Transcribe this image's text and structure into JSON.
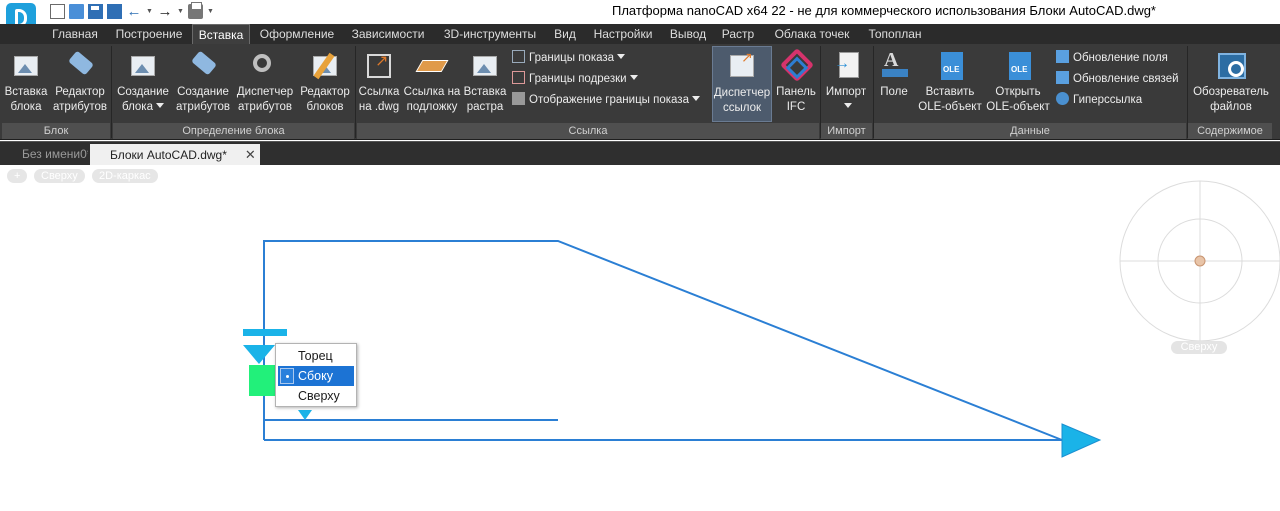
{
  "window": {
    "title": "Платформа nanoCAD x64 22 - не для коммерческого использования Блоки AutoCAD.dwg*"
  },
  "quick_access": {
    "icons": [
      "new-icon",
      "open-icon",
      "save-icon",
      "save-all-icon",
      "undo-icon",
      "redo-icon",
      "print-icon",
      "customize-icon"
    ]
  },
  "ribbon_tabs": [
    "Главная",
    "Построение",
    "Вставка",
    "Оформление",
    "Зависимости",
    "3D-инструменты",
    "Вид",
    "Настройки",
    "Вывод",
    "Растр",
    "Облака точек",
    "Топоплан"
  ],
  "active_tab": "Вставка",
  "ribbon": {
    "groups": {
      "block": "Блок",
      "block_def": "Определение блока",
      "reference": "Ссылка",
      "import": "Импорт",
      "data": "Данные",
      "content": "Содержимое"
    },
    "buttons": {
      "insert_block": [
        "Вставка",
        "блока"
      ],
      "attr_editor": [
        "Редактор",
        "атрибутов"
      ],
      "create_block": [
        "Создание",
        "блока"
      ],
      "create_attrs": [
        "Создание",
        "атрибутов"
      ],
      "attr_manager": [
        "Диспетчер",
        "атрибутов"
      ],
      "block_editor": [
        "Редактор",
        "блоков"
      ],
      "ref_dwg": [
        "Ссылка",
        "на .dwg"
      ],
      "ref_underlay": [
        "Ссылка на",
        "подложку"
      ],
      "insert_raster": [
        "Вставка",
        "растра"
      ],
      "ref_manager": [
        "Диспетчер",
        "ссылок"
      ],
      "ifc_panel": [
        "Панель",
        "IFC"
      ],
      "import": [
        "Импорт",
        ""
      ],
      "field": [
        "Поле",
        ""
      ],
      "insert_ole": [
        "Вставить",
        "OLE-объект"
      ],
      "open_ole": [
        "Открыть",
        "OLE-объект"
      ],
      "file_browser": [
        "Обозреватель",
        "файлов"
      ]
    },
    "small": {
      "display_bounds": "Границы показа",
      "clip_bounds": "Границы подрезки",
      "show_clip_bounds": "Отображение границы показа",
      "update_field": "Обновление поля",
      "update_links": "Обновление связей",
      "hyperlink": "Гиперссылка"
    },
    "ole_label": "OLE"
  },
  "document_tabs": [
    {
      "label": "Без имени0*",
      "active": false
    },
    {
      "label": "Блоки AutoCAD.dwg*",
      "active": true
    }
  ],
  "viewport": {
    "plus": "+",
    "view": "Сверху",
    "visual_style": "2D-каркас"
  },
  "context_menu": {
    "items": [
      "Торец",
      "Сбоку",
      "Сверху"
    ],
    "selected": "Сбоку"
  },
  "viewcube": {
    "label": "Сверху"
  },
  "colors": {
    "ribbon_bg": "#3a3a3a",
    "tab_bar_bg": "#2b2b2b",
    "drawing_line": "#2b7fd4",
    "grip_cyan": "#1ab3e8",
    "grip_green": "#22f07a",
    "menu_selected": "#1c73d4"
  }
}
